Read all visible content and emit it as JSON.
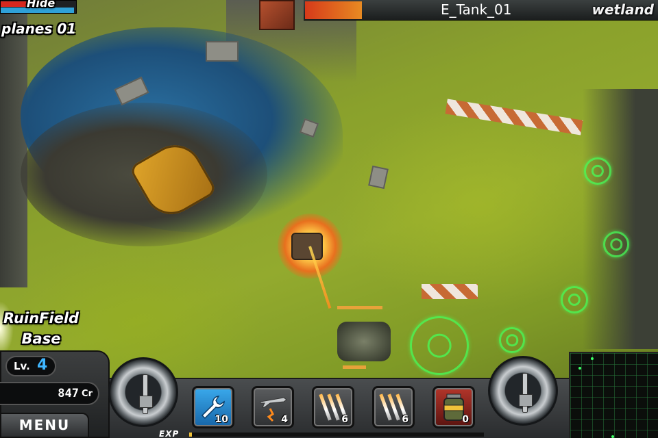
{
  "player": {
    "name": "Hide",
    "hp_fraction": 0.63,
    "shield_fraction": 0.97
  },
  "planes_label": "planes 01",
  "target": {
    "name": "E_Tank_01",
    "hp_fraction": 0.16
  },
  "zone_name": "wetland",
  "base_label_line1": "RuinField",
  "base_label_line2": "Base",
  "level": {
    "label": "Lv.",
    "value": "4"
  },
  "credits": {
    "value": "847",
    "unit": "Cr"
  },
  "menu_label": "MENU",
  "skills": [
    {
      "name": "repair",
      "icon": "wrench-icon",
      "count": "10"
    },
    {
      "name": "airstrike",
      "icon": "airstrike-plane-icon",
      "count": "4"
    },
    {
      "name": "missile-barrage-1",
      "icon": "missile-icon",
      "count": "6"
    },
    {
      "name": "missile-barrage-2",
      "icon": "missile-icon",
      "count": "6"
    },
    {
      "name": "mine",
      "icon": "mine-canister-icon",
      "count": "0"
    }
  ],
  "exp_label": "EXP",
  "exp_fraction": 0.01,
  "colors": {
    "hp_red": "#d6281f",
    "shield_blue": "#2fa1d8",
    "level_blue": "#3fb6ff",
    "radar_green": "#3dff65",
    "target_ring_green": "#46ff5a"
  }
}
